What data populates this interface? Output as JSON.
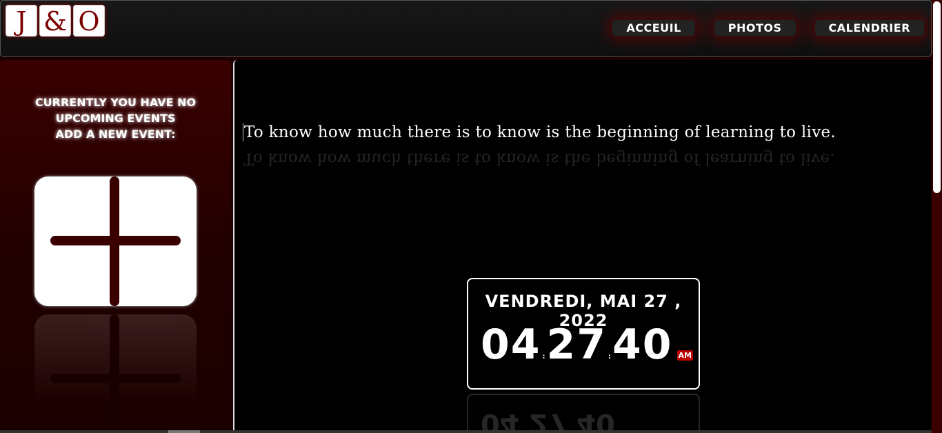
{
  "header": {
    "logo": [
      "J",
      "&",
      "O"
    ],
    "nav": [
      "ACCEUIL",
      "PHOTOS",
      "CALENDRIER"
    ]
  },
  "sidebar": {
    "message_line1": "CURRENTLY YOU HAVE NO UPCOMING EVENTS",
    "message_line2": "ADD A NEW EVENT:",
    "add_icon": "plus-icon"
  },
  "main": {
    "quote": "To know how much there is to know is the beginning of learning to live."
  },
  "clock": {
    "date": "VENDREDI, MAI 27 , 2022",
    "hours": "04",
    "minutes": "27",
    "seconds": "40",
    "ampm": "AM"
  },
  "colors": {
    "accent": "#3a0000",
    "ampm_badge": "#bb0000"
  }
}
